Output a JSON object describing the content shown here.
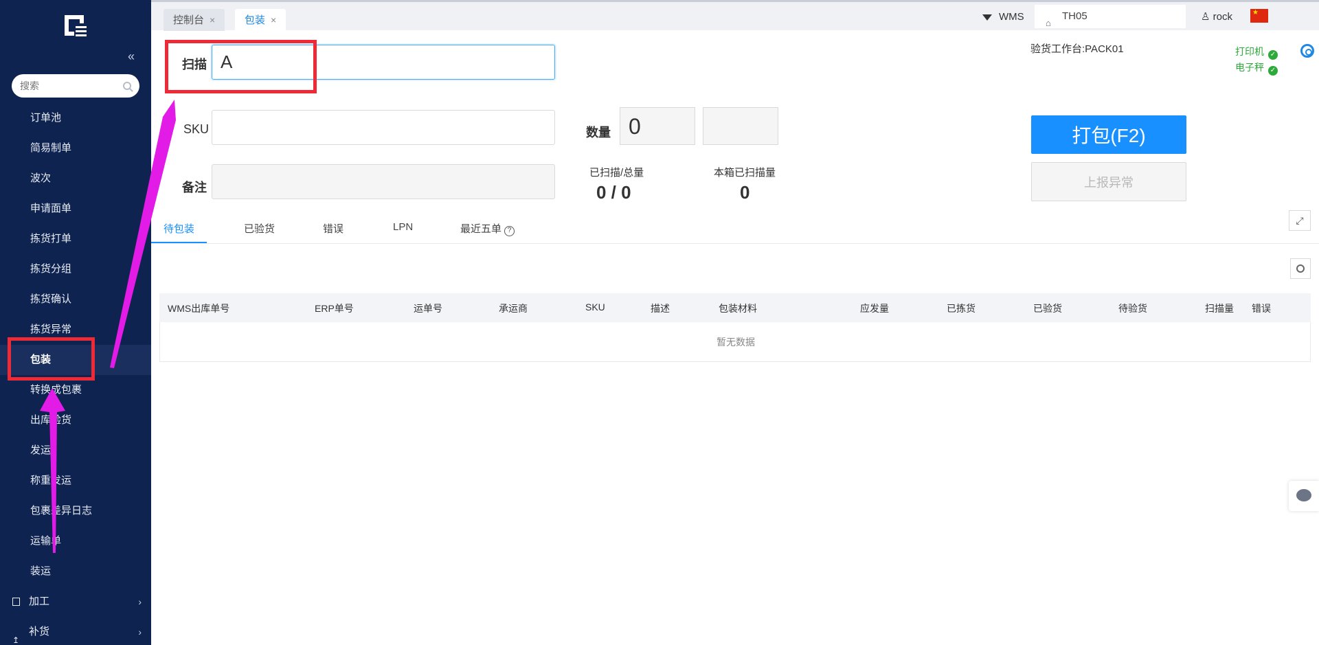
{
  "sidebar": {
    "search_placeholder": "搜索",
    "items": [
      {
        "label": "订单池"
      },
      {
        "label": "简易制单"
      },
      {
        "label": "波次"
      },
      {
        "label": "申请面单"
      },
      {
        "label": "拣货打单"
      },
      {
        "label": "拣货分组"
      },
      {
        "label": "拣货确认"
      },
      {
        "label": "拣货异常"
      },
      {
        "label": "包装"
      },
      {
        "label": "转换成包裹"
      },
      {
        "label": "出库验货"
      },
      {
        "label": "发运"
      },
      {
        "label": "称重发运"
      },
      {
        "label": "包裹差异日志"
      },
      {
        "label": "运输单"
      },
      {
        "label": "装运"
      }
    ],
    "groups": [
      {
        "label": "加工"
      },
      {
        "label": "补货"
      }
    ]
  },
  "topbar": {
    "tabs": [
      {
        "label": "控制台"
      },
      {
        "label": "包装"
      }
    ],
    "system": "WMS",
    "warehouse": "TH05",
    "user": "rock"
  },
  "form": {
    "scan_label": "扫描",
    "scan_value": "A",
    "sku_label": "SKU",
    "sku_value": "",
    "note_label": "备注",
    "note_value": "",
    "qty_label": "数量",
    "qty_value": "0",
    "scanned_total_label": "已扫描/总量",
    "scanned_total_value": "0 / 0",
    "box_scanned_label": "本箱已扫描量",
    "box_scanned_value": "0"
  },
  "status": {
    "station": "验货工作台:PACK01",
    "printer": "打印机",
    "scale": "电子秤",
    "ok_color": "#2eaa3a"
  },
  "actions": {
    "pack": "打包(F2)",
    "report": "上报异常"
  },
  "subtabs": [
    {
      "label": "待包装"
    },
    {
      "label": "已验货"
    },
    {
      "label": "错误"
    },
    {
      "label": "LPN"
    },
    {
      "label": "最近五单"
    }
  ],
  "table": {
    "columns": [
      "WMS出库单号",
      "ERP单号",
      "运单号",
      "承运商",
      "SKU",
      "描述",
      "包装材料",
      "应发量",
      "已拣货",
      "已验货",
      "待验货",
      "扫描量",
      "错误"
    ],
    "empty_text": "暂无数据"
  },
  "colors": {
    "sidebar_bg": "#0f2350",
    "accent": "#1890ff",
    "annotation_red": "#ee2a37",
    "annotation_arrow": "#e21ce6"
  }
}
